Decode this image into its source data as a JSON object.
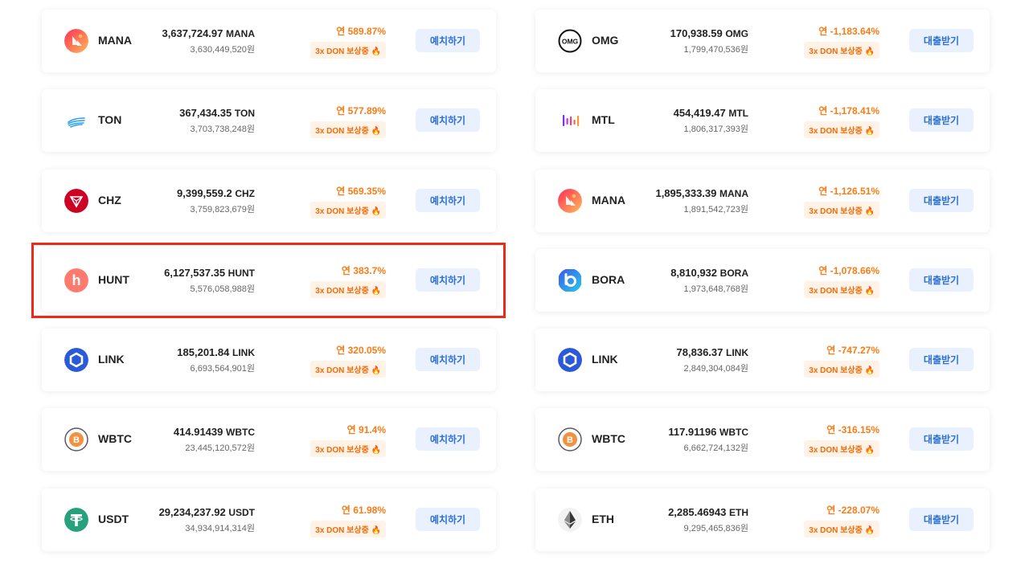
{
  "deposit": {
    "button_label": "예치하기",
    "items": [
      {
        "symbol": "MANA",
        "amount": "3,637,724.97",
        "unit": "MANA",
        "krw": "3,630,449,520원",
        "rate": "연 589.87%",
        "badge": "3x DON 보상중 🔥",
        "icon": "mana-icon"
      },
      {
        "symbol": "TON",
        "amount": "367,434.35",
        "unit": "TON",
        "krw": "3,703,738,248원",
        "rate": "연 577.89%",
        "badge": "3x DON 보상중 🔥",
        "icon": "ton-icon"
      },
      {
        "symbol": "CHZ",
        "amount": "9,399,559.2",
        "unit": "CHZ",
        "krw": "3,759,823,679원",
        "rate": "연 569.35%",
        "badge": "3x DON 보상중 🔥",
        "icon": "chz-icon"
      },
      {
        "symbol": "HUNT",
        "amount": "6,127,537.35",
        "unit": "HUNT",
        "krw": "5,576,058,988원",
        "rate": "연 383.7%",
        "badge": "3x DON 보상중 🔥",
        "icon": "hunt-icon"
      },
      {
        "symbol": "LINK",
        "amount": "185,201.84",
        "unit": "LINK",
        "krw": "6,693,564,901원",
        "rate": "연 320.05%",
        "badge": "3x DON 보상중 🔥",
        "icon": "link-icon"
      },
      {
        "symbol": "WBTC",
        "amount": "414.91439",
        "unit": "WBTC",
        "krw": "23,445,120,572원",
        "rate": "연 91.4%",
        "badge": "3x DON 보상중 🔥",
        "icon": "wbtc-icon"
      },
      {
        "symbol": "USDT",
        "amount": "29,234,237.92",
        "unit": "USDT",
        "krw": "34,934,914,314원",
        "rate": "연 61.98%",
        "badge": "3x DON 보상중 🔥",
        "icon": "usdt-icon"
      }
    ]
  },
  "loan": {
    "button_label": "대출받기",
    "items": [
      {
        "symbol": "OMG",
        "amount": "170,938.59",
        "unit": "OMG",
        "krw": "1,799,470,536원",
        "rate": "연 -1,183.64%",
        "badge": "3x DON 보상중 🔥",
        "icon": "omg-icon"
      },
      {
        "symbol": "MTL",
        "amount": "454,419.47",
        "unit": "MTL",
        "krw": "1,806,317,393원",
        "rate": "연 -1,178.41%",
        "badge": "3x DON 보상중 🔥",
        "icon": "mtl-icon"
      },
      {
        "symbol": "MANA",
        "amount": "1,895,333.39",
        "unit": "MANA",
        "krw": "1,891,542,723원",
        "rate": "연 -1,126.51%",
        "badge": "3x DON 보상중 🔥",
        "icon": "mana-icon"
      },
      {
        "symbol": "BORA",
        "amount": "8,810,932",
        "unit": "BORA",
        "krw": "1,973,648,768원",
        "rate": "연 -1,078.66%",
        "badge": "3x DON 보상중 🔥",
        "icon": "bora-icon"
      },
      {
        "symbol": "LINK",
        "amount": "78,836.37",
        "unit": "LINK",
        "krw": "2,849,304,084원",
        "rate": "연 -747.27%",
        "badge": "3x DON 보상중 🔥",
        "icon": "link-icon"
      },
      {
        "symbol": "WBTC",
        "amount": "117.91196",
        "unit": "WBTC",
        "krw": "6,662,724,132원",
        "rate": "연 -316.15%",
        "badge": "3x DON 보상중 🔥",
        "icon": "wbtc-icon"
      },
      {
        "symbol": "ETH",
        "amount": "2,285.46943",
        "unit": "ETH",
        "krw": "9,295,465,836원",
        "rate": "연 -228.07%",
        "badge": "3x DON 보상중 🔥",
        "icon": "eth-icon"
      }
    ]
  },
  "colors": {
    "accent_orange": "#fb7b14",
    "button_bg": "#e8f1fd",
    "button_text": "#2c6fd6",
    "highlight": "#ee2a16"
  }
}
